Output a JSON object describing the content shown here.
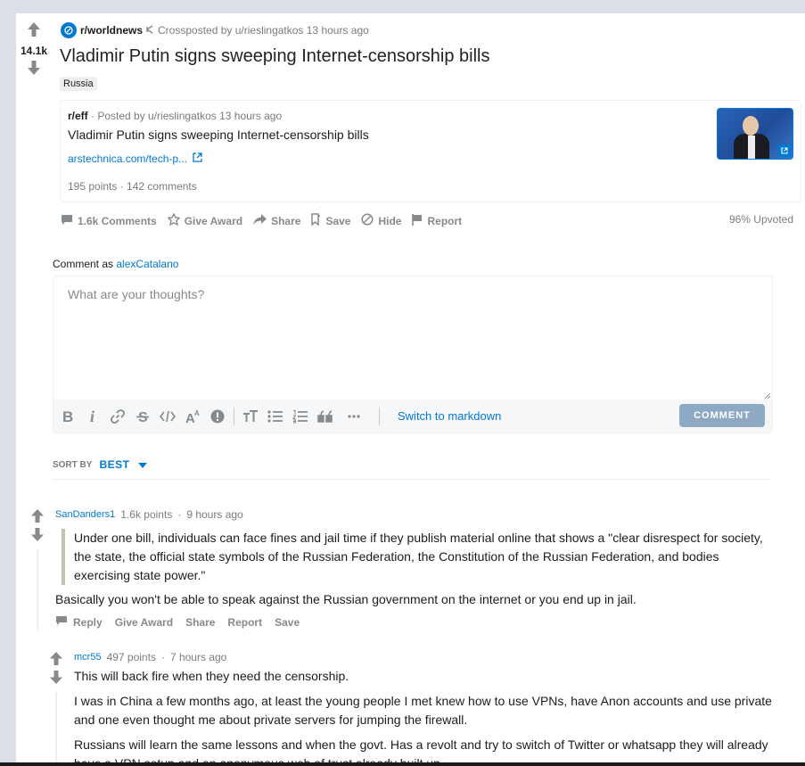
{
  "post": {
    "score": "14.1k",
    "subreddit": "r/worldnews",
    "crosspost_label": "Crossposted by u/rieslingatkos 13 hours ago",
    "title": "Vladimir Putin signs sweeping Internet-censorship bills",
    "flair": "Russia"
  },
  "crosspost": {
    "subreddit": "r/eff",
    "meta": "· Posted by u/rieslingatkos 13 hours ago",
    "title": "Vladimir Putin signs sweeping Internet-censorship bills",
    "link": "arstechnica.com/tech-p...",
    "stats": "195 points · 142 comments"
  },
  "actions": {
    "comments": "1.6k Comments",
    "award": "Give Award",
    "share": "Share",
    "save": "Save",
    "hide": "Hide",
    "report": "Report",
    "upvoted": "96% Upvoted"
  },
  "editor": {
    "comment_as_label": "Comment as",
    "username": "alexCatalano",
    "placeholder": "What are your thoughts?",
    "switch_markdown": "Switch to markdown",
    "comment_button": "COMMENT"
  },
  "sort": {
    "label": "SORT BY",
    "value": "BEST"
  },
  "comments": [
    {
      "author": "SanDanders1",
      "points": "1.6k points",
      "time": "9 hours ago",
      "quote": "Under one bill, individuals can face fines and jail time if they publish material online that shows a \"clear disrespect for society, the state, the official state symbols of the Russian Federation, the Constitution of the Russian Federation, and bodies exercising state power.\"",
      "text": "Basically you won't be able to speak against the Russian government on the internet or you end up in jail.",
      "actions": [
        "Reply",
        "Give Award",
        "Share",
        "Report",
        "Save"
      ]
    },
    {
      "author": "mcr55",
      "points": "497 points",
      "time": "7 hours ago",
      "paragraphs": [
        "This will back fire when they need the censorship.",
        "I was in China a few months ago, at least the young people I met knew how to use VPNs, have Anon accounts and use private and one even thought me about private servers for jumping the firewall.",
        "Russians will learn the same lessons and when the govt. Has a revolt and try to switch of Twitter or whatsapp they will already have a VPN setup and an anonymous web of trust already built up."
      ]
    }
  ],
  "colors": {
    "accent": "#0079d3",
    "page_bg": "#dae0e6",
    "comment_button_disabled": "#8ea9c3"
  }
}
